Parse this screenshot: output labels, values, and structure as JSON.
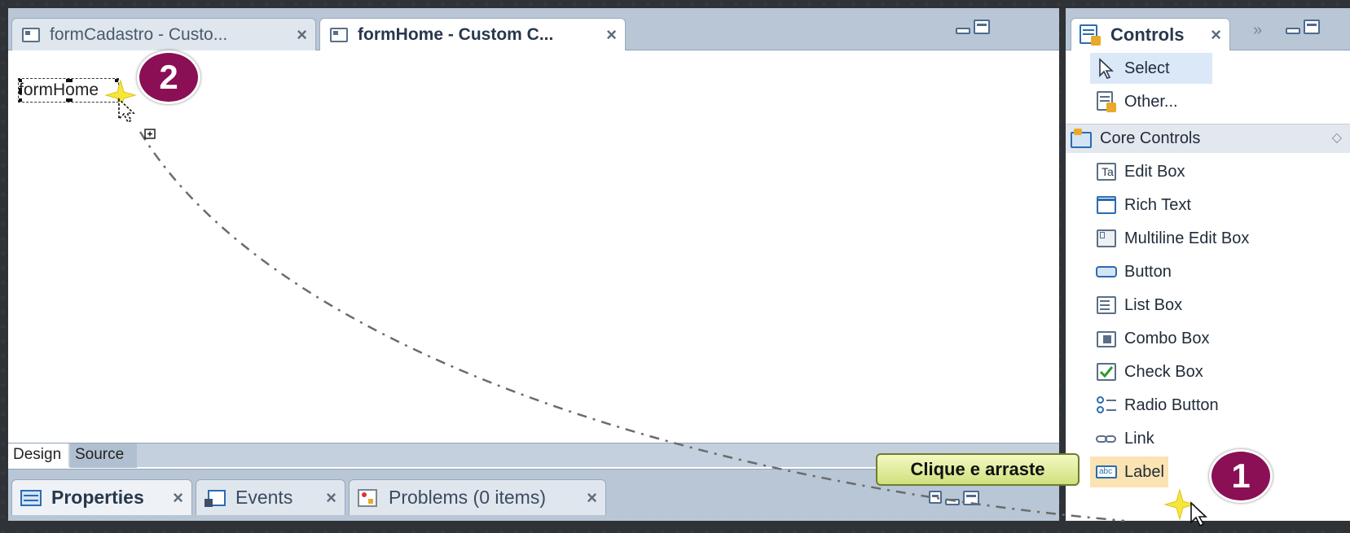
{
  "editor": {
    "tabs": [
      {
        "label": "formCadastro - Custo...",
        "active": false,
        "icon": "form-icon"
      },
      {
        "label": "formHome - Custom C...",
        "active": true,
        "icon": "form-icon"
      }
    ],
    "close_glyph": "×",
    "canvas": {
      "selected_label_text": "formHome"
    },
    "mode_tabs": {
      "design": "Design",
      "source": "Source"
    }
  },
  "bottom_tabs": [
    {
      "label": "Properties",
      "icon": "properties-icon",
      "active": true
    },
    {
      "label": "Events",
      "icon": "events-icon",
      "active": false
    },
    {
      "label": "Problems (0 items)",
      "icon": "problems-icon",
      "active": false
    }
  ],
  "palette": {
    "tab_title": "Controls",
    "chevron_glyph": "»",
    "top_items": [
      {
        "label": "Select",
        "icon": "pointer-icon"
      },
      {
        "label": "Other...",
        "icon": "other-icon"
      }
    ],
    "section_header": "Core Controls",
    "section_chevron": "◇",
    "core_items": [
      {
        "label": "Edit Box",
        "icon": "edit-box-icon"
      },
      {
        "label": "Rich Text",
        "icon": "rich-text-icon"
      },
      {
        "label": "Multiline Edit Box",
        "icon": "multiline-edit-box-icon"
      },
      {
        "label": "Button",
        "icon": "button-icon"
      },
      {
        "label": "List Box",
        "icon": "list-box-icon"
      },
      {
        "label": "Combo Box",
        "icon": "combo-box-icon"
      },
      {
        "label": "Check Box",
        "icon": "check-box-icon"
      },
      {
        "label": "Radio Button",
        "icon": "radio-button-icon"
      },
      {
        "label": "Link",
        "icon": "link-icon"
      },
      {
        "label": "Label",
        "icon": "label-icon"
      }
    ]
  },
  "annotations": {
    "step1": "1",
    "step2": "2",
    "callout": "Clique e arraste"
  },
  "colors": {
    "badge": "#8b0f55",
    "callout": "#e3ee9e",
    "panel_header": "#b8c6d6"
  }
}
